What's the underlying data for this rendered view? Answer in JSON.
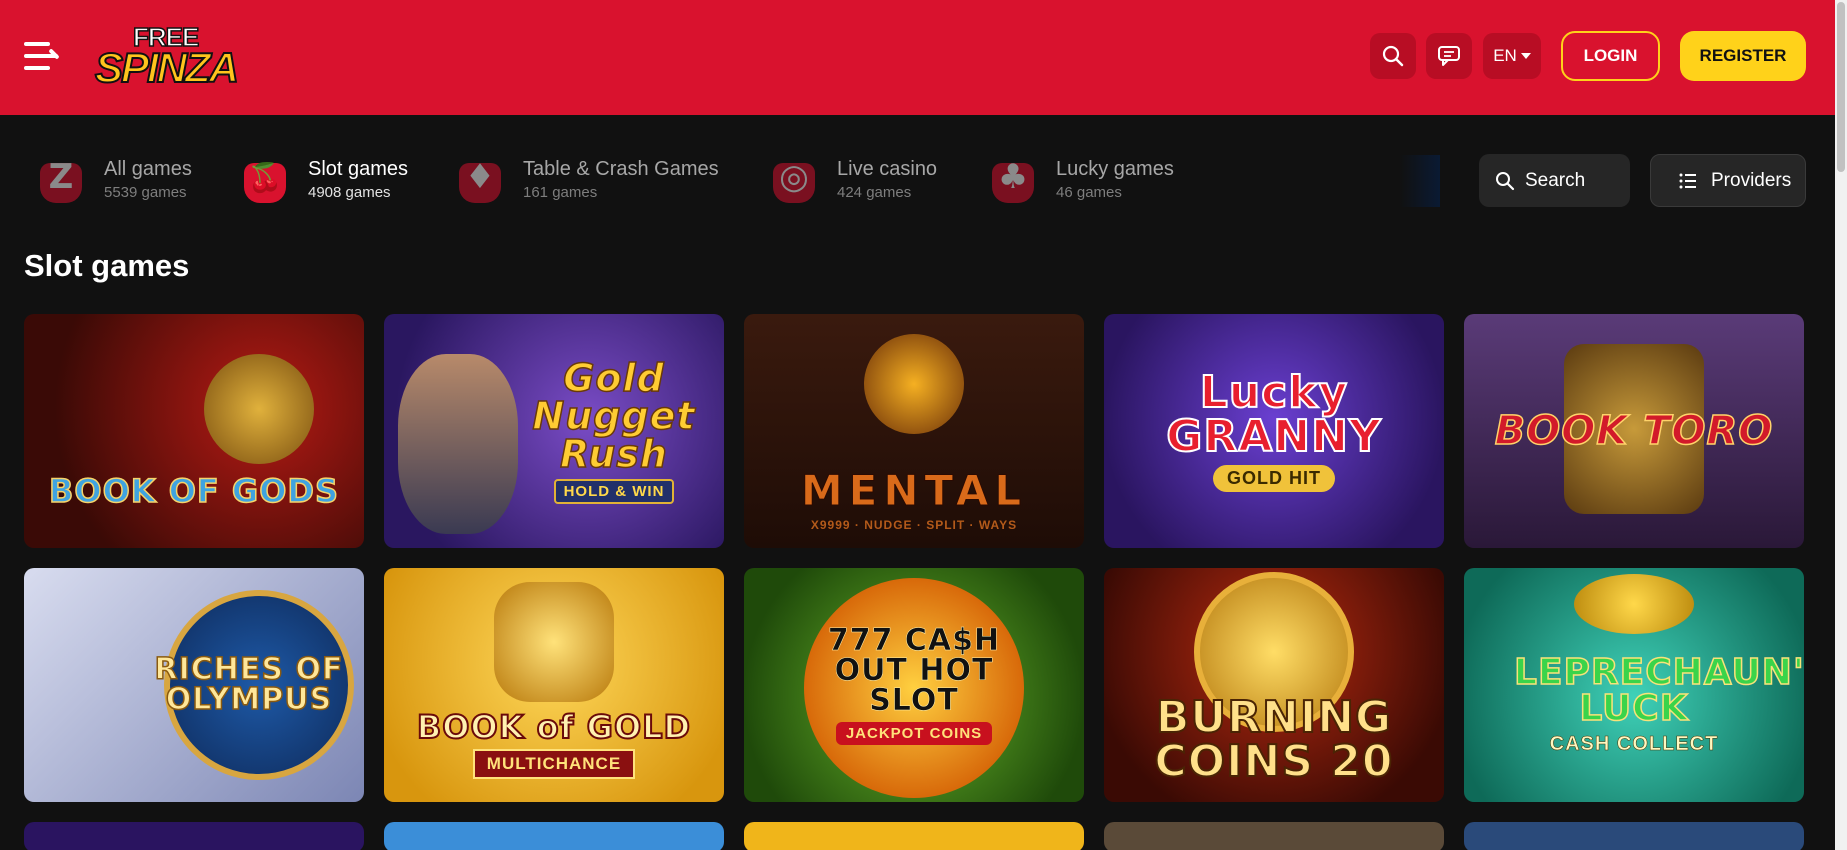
{
  "header": {
    "menu_icon": "menu-icon",
    "logo": {
      "top": "FREE",
      "bottom": "SPINZA"
    },
    "search_icon": "search-icon",
    "chat_icon": "chat-icon",
    "language": "EN",
    "login_label": "LOGIN",
    "register_label": "REGISTER"
  },
  "categories": [
    {
      "title": "All games",
      "subtitle": "5539 games",
      "icon": "z-logo-icon",
      "glyph": "Z",
      "active": false
    },
    {
      "title": "Slot games",
      "subtitle": "4908 games",
      "icon": "cherries-icon",
      "glyph": "🍒",
      "active": true
    },
    {
      "title": "Table & Crash Games",
      "subtitle": "161 games",
      "icon": "cards-icon",
      "glyph": "♦",
      "active": false
    },
    {
      "title": "Live casino",
      "subtitle": "424 games",
      "icon": "roulette-icon",
      "glyph": "◎",
      "active": false
    },
    {
      "title": "Lucky games",
      "subtitle": "46 games",
      "icon": "clover-icon",
      "glyph": "♣",
      "active": false
    }
  ],
  "search": {
    "label": "Search"
  },
  "providers": {
    "label": "Providers"
  },
  "section_title": "Slot games",
  "games": [
    {
      "title": "BOOK OF GODS",
      "sub": ""
    },
    {
      "title": "Gold Nugget Rush",
      "sub": "HOLD & WIN"
    },
    {
      "title": "MENTAL",
      "sub": "X9999 · NUDGE · SPLIT · WAYS"
    },
    {
      "title": "Lucky GRANNY",
      "sub": "GOLD HIT"
    },
    {
      "title": "BOOK TORO",
      "sub": ""
    },
    {
      "title": "RICHES OF OLYMPUS",
      "sub": ""
    },
    {
      "title": "BOOK of GOLD",
      "sub": "MULTICHANCE"
    },
    {
      "title": "777 CA$H OUT HOT SLOT",
      "sub": "JACKPOT COINS"
    },
    {
      "title": "BURNING COINS 20",
      "sub": ""
    },
    {
      "title": "LEPRECHAUN'S LUCK",
      "sub": "CASH COLLECT"
    }
  ],
  "colors": {
    "header_bg": "#d9122e",
    "accent_yellow": "#ffd21a",
    "page_bg": "#111111",
    "control_bg": "#262626"
  }
}
